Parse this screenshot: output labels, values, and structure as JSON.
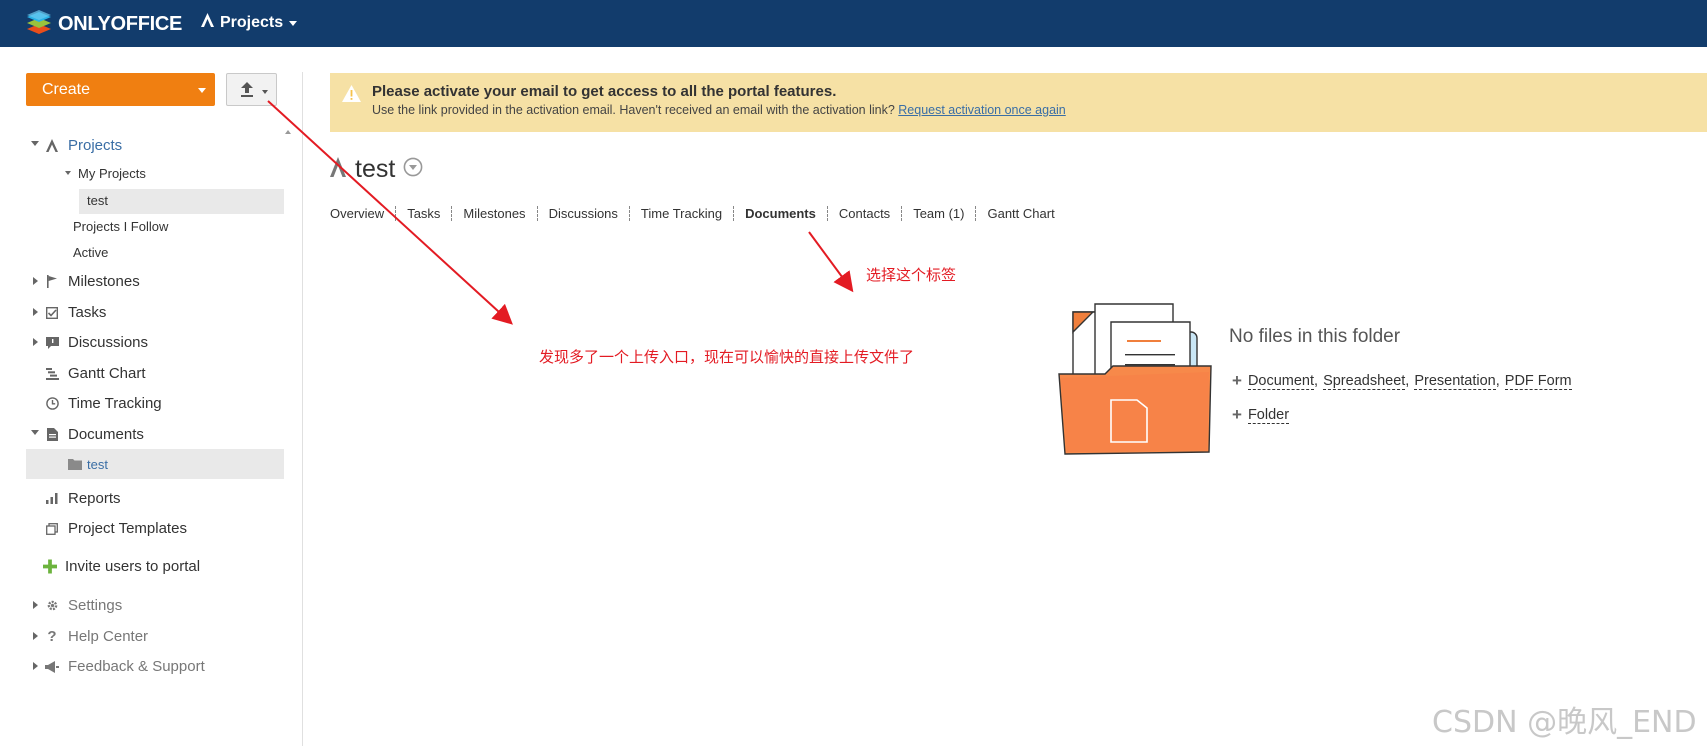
{
  "header": {
    "brand": "ONLYOFFICE",
    "module": "Projects"
  },
  "sidebar": {
    "create_label": "Create",
    "items": {
      "projects": "Projects",
      "my_projects": "My Projects",
      "test_project": "test",
      "projects_follow": "Projects I Follow",
      "active": "Active",
      "milestones": "Milestones",
      "tasks": "Tasks",
      "discussions": "Discussions",
      "gantt": "Gantt Chart",
      "time_tracking": "Time Tracking",
      "documents": "Documents",
      "docs_test": "test",
      "reports": "Reports",
      "templates": "Project Templates",
      "invite": "Invite users to portal",
      "settings": "Settings",
      "help": "Help Center",
      "feedback": "Feedback & Support"
    }
  },
  "banner": {
    "title": "Please activate your email to get access to all the portal features.",
    "text": "Use the link provided in the activation email. Haven't received an email with the activation link?",
    "link": "Request activation once again"
  },
  "project": {
    "name": "test",
    "tabs": [
      "Overview",
      "Tasks",
      "Milestones",
      "Discussions",
      "Time Tracking",
      "Documents",
      "Contacts",
      "Team (1)",
      "Gantt Chart"
    ],
    "active_tab": "Documents"
  },
  "empty": {
    "title": "No files in this folder",
    "create_links": [
      "Document",
      "Spreadsheet",
      "Presentation",
      "PDF Form"
    ],
    "folder_link": "Folder"
  },
  "annotations": {
    "upload_note": "发现多了一个上传入口，现在可以愉快的直接上传文件了",
    "tab_note": "选择这个标签",
    "watermark": "CSDN @晚风_END"
  },
  "colors": {
    "topbar": "#123c6c",
    "create_button": "#f07f11",
    "banner": "#f6e1a5",
    "link": "#3a6ea5",
    "annotation": "#e31b23"
  }
}
